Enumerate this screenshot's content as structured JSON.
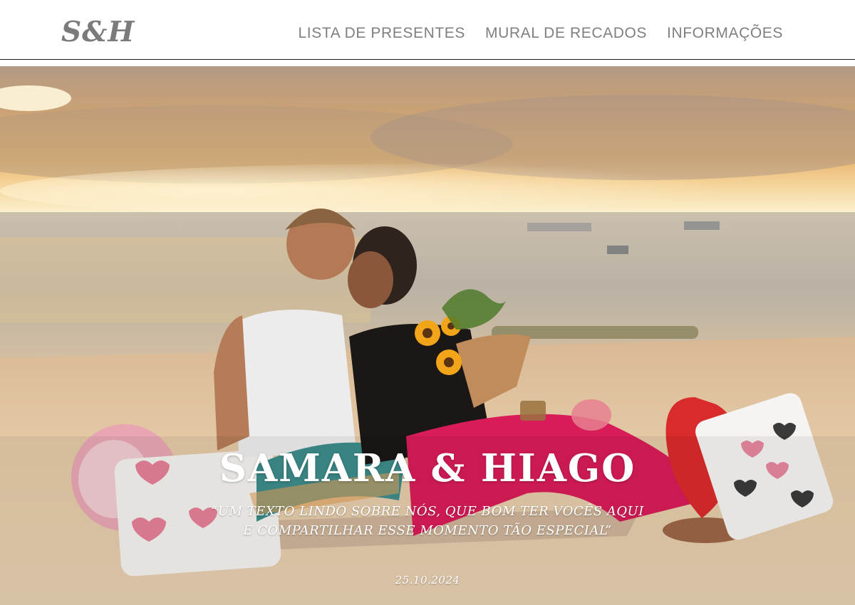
{
  "header": {
    "logo": "S&H",
    "nav": [
      {
        "label": "LISTA DE PRESENTES"
      },
      {
        "label": "MURAL DE RECADOS"
      },
      {
        "label": "INFORMAÇÕES"
      }
    ]
  },
  "hero": {
    "names": "SAMARA & HIAGO",
    "quote_line1": "“UM TEXTO LINDO SOBRE NÓS, QUE BOM TER VOCÊS AQUI",
    "quote_line2": "E COMPARTILHAR ESSE MOMENTO TÃO ESPECIAL”",
    "date": "25.10.2024"
  },
  "colors": {
    "nav_text": "#7f7f7f",
    "logo": "#7b7b7b",
    "divider": "#1a1a1a",
    "hero_text": "#ffffff"
  }
}
